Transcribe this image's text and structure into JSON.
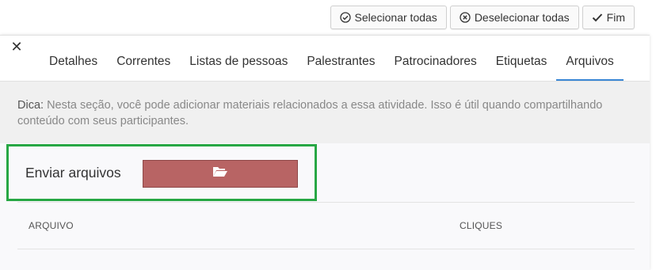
{
  "toolbar": {
    "select_all": {
      "label": "Selecionar todas",
      "icon": "check-circle-icon"
    },
    "deselect_all": {
      "label": "Deselecionar todas",
      "icon": "x-circle-icon"
    },
    "done": {
      "label": "Fim",
      "icon": "check-icon"
    }
  },
  "panel": {
    "close_label": "✕",
    "tabs": [
      {
        "label": "Detalhes",
        "active": false
      },
      {
        "label": "Correntes",
        "active": false
      },
      {
        "label": "Listas de pessoas",
        "active": false
      },
      {
        "label": "Palestrantes",
        "active": false
      },
      {
        "label": "Patrocinadores",
        "active": false
      },
      {
        "label": "Etiquetas",
        "active": false
      },
      {
        "label": "Arquivos",
        "active": true
      }
    ],
    "hint": {
      "prefix": "Dica:",
      "text": " Nesta seção, você pode adicionar materiais relacionados a essa atividade. Isso é útil quando compartilhando conteúdo com seus participantes."
    },
    "upload": {
      "label": "Enviar arquivos",
      "button_icon": "folder-open-icon"
    },
    "files_table": {
      "columns": [
        "ARQUIVO",
        "CLIQUES"
      ]
    }
  },
  "colors": {
    "active_tab_underline": "#3a86d4",
    "upload_button": "#b86464",
    "highlight_frame": "#27a744",
    "hint_background": "#f0f0f0"
  }
}
